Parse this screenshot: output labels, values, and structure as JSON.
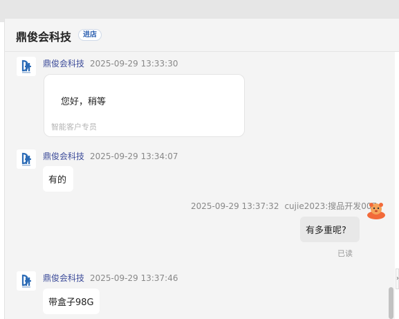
{
  "header": {
    "shop_name": "鼎俊会科技",
    "enter_shop": "进店"
  },
  "messages": [
    {
      "sender": "鼎俊会科技",
      "time": "2025-09-29 13:33:30",
      "card_text": "您好，稍等",
      "card_sub": "智能客户专员"
    },
    {
      "sender": "鼎俊会科技",
      "time": "2025-09-29 13:34:07",
      "text": "有的"
    },
    {
      "sender": "cujie2023:搜品开发007",
      "time": "2025-09-29 13:37:32",
      "text": "有多重呢?",
      "status": "已读"
    },
    {
      "sender": "鼎俊会科技",
      "time": "2025-09-29 13:37:46",
      "text": "带盒子98G"
    }
  ],
  "colors": {
    "brand_blue": "#2b6bb6",
    "user_avatar": "#f26a3a"
  },
  "icons": {
    "shop_logo": "djh-logo-icon",
    "user_avatar": "bear-avatar-icon"
  }
}
